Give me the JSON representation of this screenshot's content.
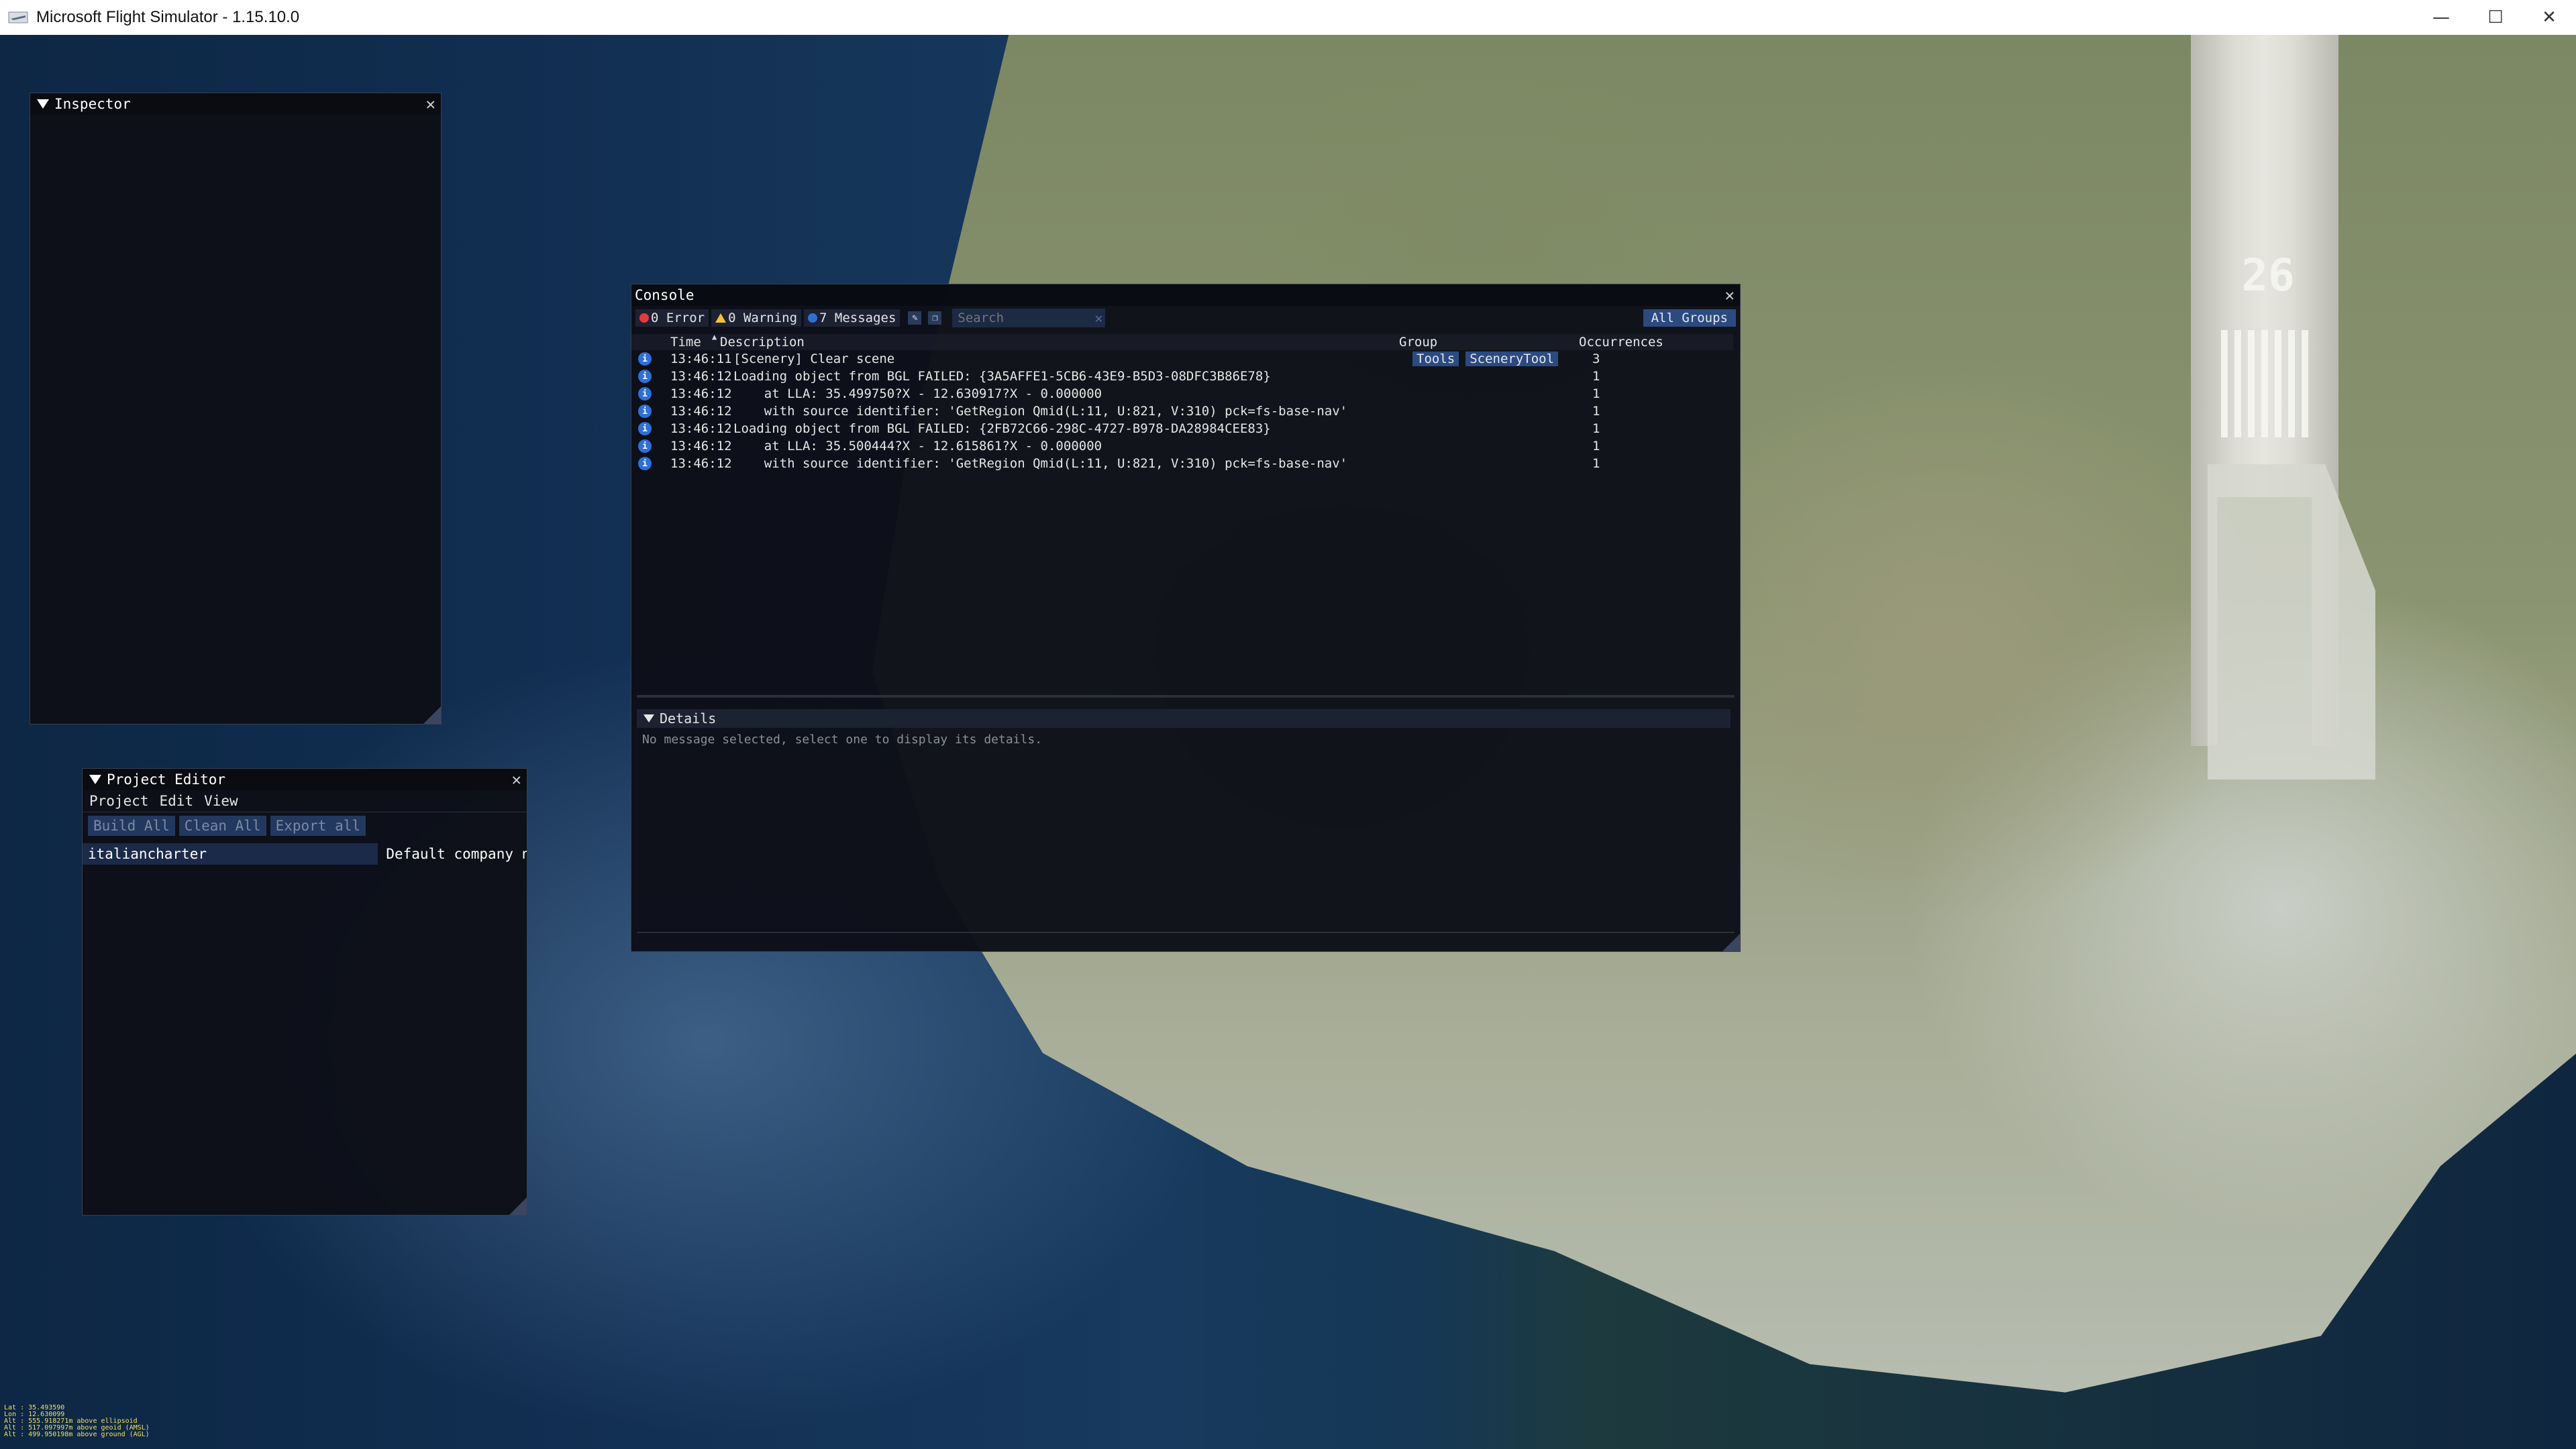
{
  "window": {
    "title": "Microsoft Flight Simulator - 1.15.10.0",
    "controls": {
      "minimize": "—",
      "maximize": "☐",
      "close": "✕"
    }
  },
  "scenery": {
    "runway_number": "26"
  },
  "inspector": {
    "title": "Inspector",
    "close": "✕"
  },
  "project_editor": {
    "title": "Project Editor",
    "close": "✕",
    "menu": [
      "Project",
      "Edit",
      "View"
    ],
    "buttons": [
      "Build All",
      "Clean All",
      "Export all"
    ],
    "project": {
      "name": "italiancharter",
      "company": "Default company n"
    }
  },
  "console": {
    "title": "Console",
    "close": "✕",
    "filters": {
      "error": "0 Error",
      "warning": "0 Warning",
      "messages": "7 Messages"
    },
    "search_placeholder": "Search",
    "search_clear": "✕",
    "groups_select": "All Groups",
    "columns": {
      "time": "Time",
      "description": "Description",
      "group": "Group",
      "occurrences": "Occurrences"
    },
    "rows": [
      {
        "time": "13:46:11",
        "description": "[Scenery] Clear scene",
        "groups": [
          "Tools",
          "SceneryTool"
        ],
        "occurrences": "3"
      },
      {
        "time": "13:46:12",
        "description": "Loading object from BGL FAILED: {3A5AFFE1-5CB6-43E9-B5D3-08DFC3B86E78}",
        "groups": [],
        "occurrences": "1"
      },
      {
        "time": "13:46:12",
        "description": "    at LLA: 35.499750?X - 12.630917?X - 0.000000",
        "groups": [],
        "occurrences": "1"
      },
      {
        "time": "13:46:12",
        "description": "    with source identifier: 'GetRegion Qmid(L:11, U:821, V:310) pck=fs-base-nav'",
        "groups": [],
        "occurrences": "1"
      },
      {
        "time": "13:46:12",
        "description": "Loading object from BGL FAILED: {2FB72C66-298C-4727-B978-DA28984CEE83}",
        "groups": [],
        "occurrences": "1"
      },
      {
        "time": "13:46:12",
        "description": "    at LLA: 35.500444?X - 12.615861?X - 0.000000",
        "groups": [],
        "occurrences": "1"
      },
      {
        "time": "13:46:12",
        "description": "    with source identifier: 'GetRegion Qmid(L:11, U:821, V:310) pck=fs-base-nav'",
        "groups": [],
        "occurrences": "1"
      }
    ],
    "details": {
      "title": "Details",
      "empty_text": "No message selected, select one to display its details."
    }
  },
  "coordinates_overlay": [
    "Lat : 35.493590",
    "Lon : 12.630099",
    "Alt : 555.918271m above ellipsoid",
    "Alt : 517.097997m above geoid (AMSL)",
    "Alt : 499.950198m above ground (AGL)"
  ]
}
